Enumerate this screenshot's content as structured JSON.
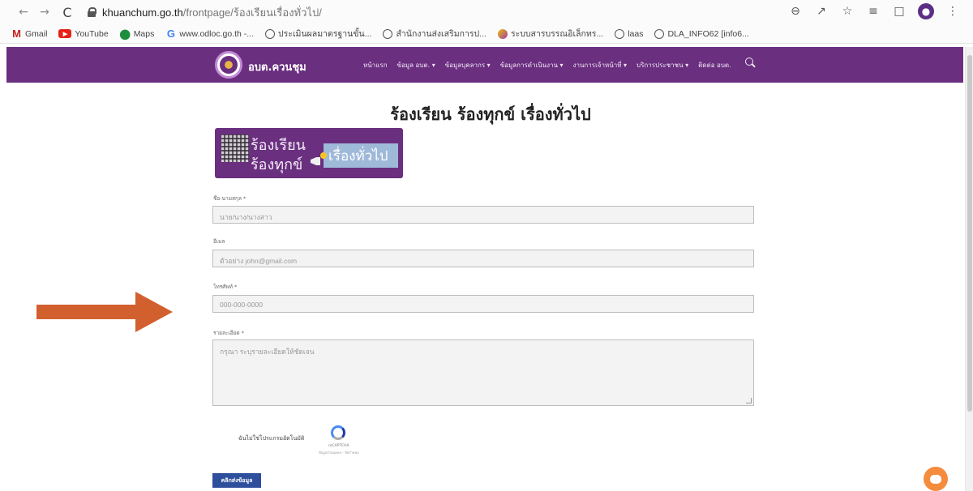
{
  "browser": {
    "url_host": "khuanchum.go.th",
    "url_path": "/frontpage/ร้องเรียนเรื่องทั่วไป/",
    "bookmarks": [
      {
        "label": "Gmail",
        "icon": "gmail-icon"
      },
      {
        "label": "YouTube",
        "icon": "youtube-icon"
      },
      {
        "label": "Maps",
        "icon": "maps-icon"
      },
      {
        "label": "www.odloc.go.th -...",
        "icon": "google-icon"
      },
      {
        "label": "ประเมินผลมาตรฐานขั้น...",
        "icon": "globe-icon"
      },
      {
        "label": "สำนักงานส่งเสริมการป...",
        "icon": "globe-icon"
      },
      {
        "label": "ระบบสารบรรณอิเล็กทร...",
        "icon": "circle-icon"
      },
      {
        "label": "laas",
        "icon": "globe-icon"
      },
      {
        "label": "DLA_INFO62 [info6...",
        "icon": "globe-icon"
      }
    ]
  },
  "site": {
    "name": "อบต.ควนชุม",
    "menu": [
      "หน้าแรก",
      "ข้อมูล อบต. ▾",
      "ข้อมูลบุคลากร ▾",
      "ข้อมูลการดำเนินงาน ▾",
      "งานการเจ้าหน้าที่ ▾",
      "บริการประชาชน ▾",
      "ติดต่อ อบต."
    ]
  },
  "page": {
    "title": "ร้องเรียน ร้องทุกข์ เรื่องทั่วไป",
    "banner_line1": "ร้องเรียน",
    "banner_line2": "ร้องทุกข์",
    "banner_highlight": "เรื่องทั่วไป"
  },
  "form": {
    "name_label": "ชื่อ-นามสกุล *",
    "name_placeholder": "นาย/นาง/นางสาว",
    "email_label": "อีเมล",
    "email_placeholder": "ตัวอย่าง john@gmail.com",
    "phone_label": "โทรศัพท์ *",
    "phone_placeholder": "000-000-0000",
    "detail_label": "รายละเอียด *",
    "detail_placeholder": "กรุณา ระบุรายละเอียดให้ชัดเจน",
    "captcha_text": "ฉันไม่ใช่โปรแกรมอัตโนมัติ",
    "captcha_brand": "reCAPTCHA",
    "captcha_privacy": "ข้อมูลส่วนบุคคล - ข้อกำหนด",
    "submit_label": "คลิกส่งข้อมูล"
  },
  "colors": {
    "nav_purple": "#6a2f7f",
    "arrow_orange": "#d2602f",
    "button_blue": "#2e4f9b",
    "chat_orange": "#f58b3d"
  }
}
